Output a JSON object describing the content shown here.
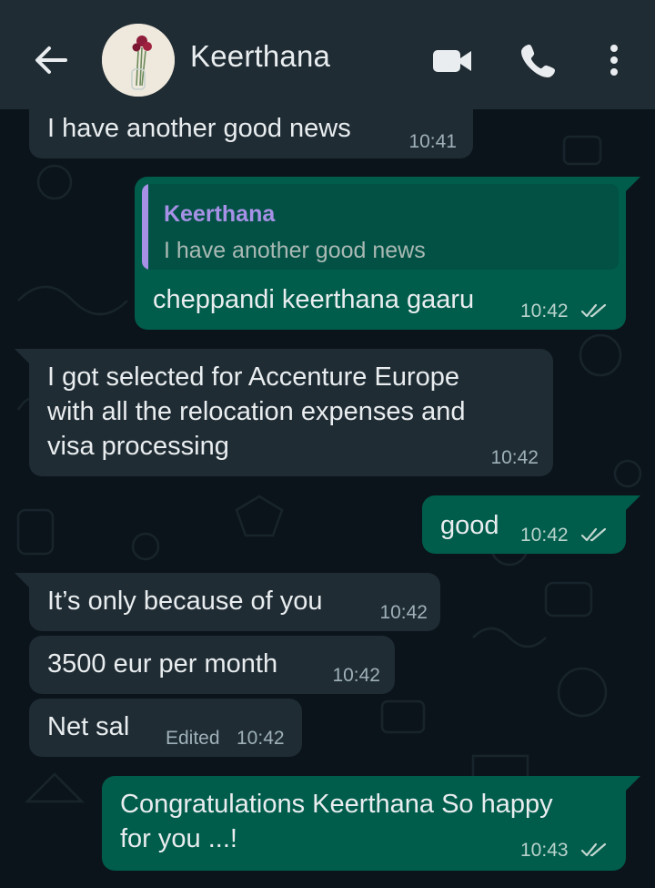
{
  "header": {
    "contact_name": "Keerthana",
    "icons": [
      "back-arrow-icon",
      "video-call-icon",
      "voice-call-icon",
      "more-options-icon"
    ]
  },
  "colors": {
    "header_bg": "#1f2c34",
    "chat_bg": "#0b141a",
    "incoming_bubble": "#1f2c34",
    "outgoing_bubble": "#005c4b",
    "quote_accent": "#a791e6",
    "read_ticks": "#c2d6d0"
  },
  "messages": [
    {
      "direction": "incoming",
      "text": "I have another good news",
      "time": "10:41"
    },
    {
      "direction": "outgoing",
      "quote": {
        "author": "Keerthana",
        "text": "I have another good news"
      },
      "text": "cheppandi keerthana gaaru",
      "time": "10:42",
      "status": "read"
    },
    {
      "direction": "incoming",
      "lines": [
        "I got selected for Accenture Europe",
        "with all the relocation expenses and",
        "visa processing"
      ],
      "time": "10:42"
    },
    {
      "direction": "outgoing",
      "text": "good",
      "time": "10:42",
      "status": "read"
    },
    {
      "direction": "incoming",
      "text": "It’s only because of you",
      "time": "10:42"
    },
    {
      "direction": "incoming",
      "text": "3500 eur per month",
      "time": "10:42"
    },
    {
      "direction": "incoming",
      "text": "Net sal",
      "edited_label": "Edited",
      "time": "10:42"
    },
    {
      "direction": "outgoing",
      "lines": [
        "Congratulations Keerthana So happy",
        "for you ...!"
      ],
      "time": "10:43",
      "status": "read"
    }
  ]
}
